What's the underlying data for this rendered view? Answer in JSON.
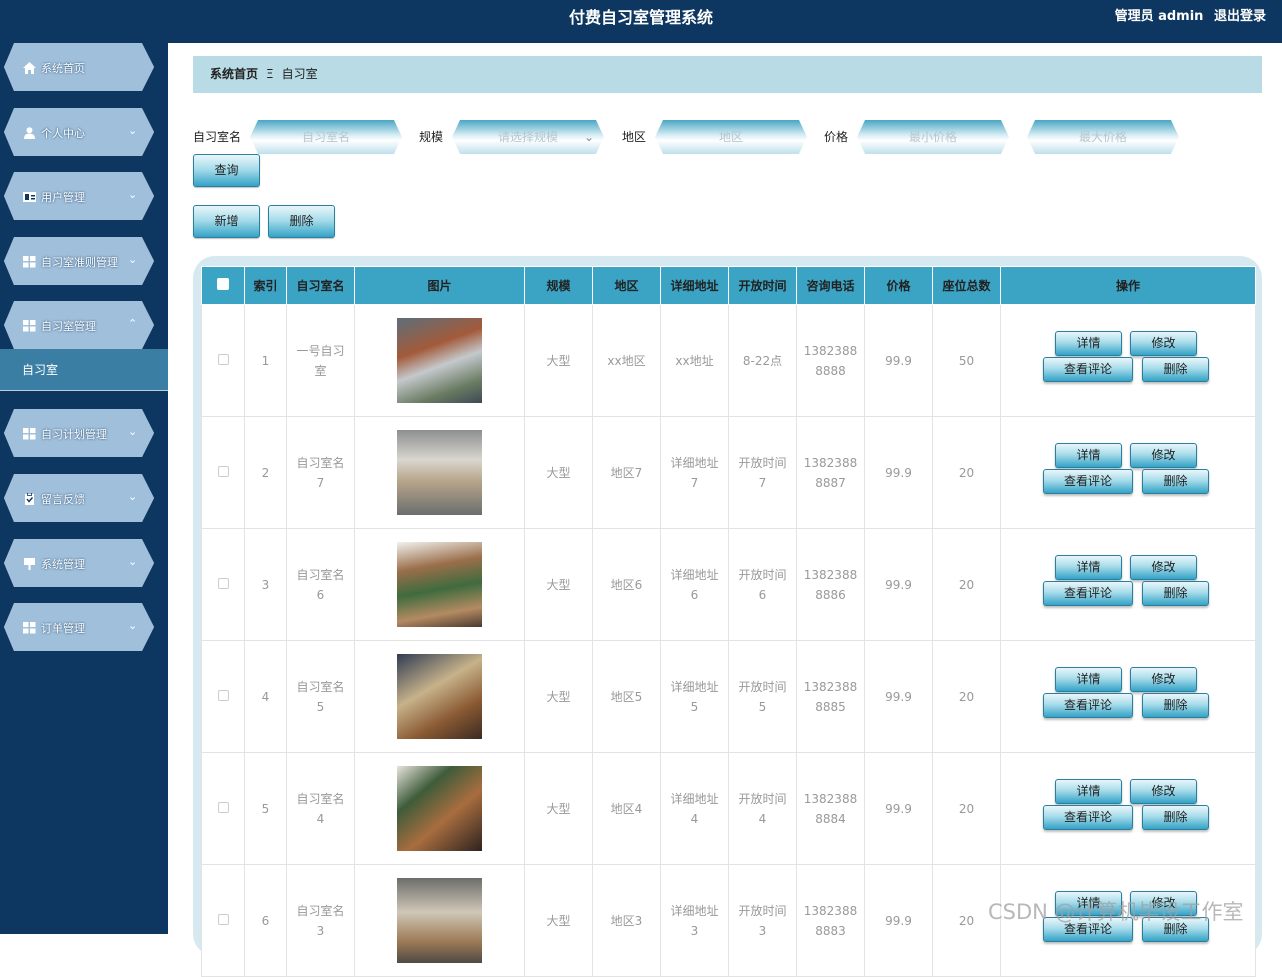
{
  "header": {
    "title": "付费自习室管理系统",
    "user_label": "管理员 admin",
    "logout_label": "退出登录"
  },
  "sidebar": {
    "items": [
      {
        "label": "系统首页",
        "icon": "home-icon",
        "chevron": ""
      },
      {
        "label": "个人中心",
        "icon": "user-icon",
        "chevron": "⌄"
      },
      {
        "label": "用户管理",
        "icon": "id-card-icon",
        "chevron": "⌄"
      },
      {
        "label": "自习室准则管理",
        "icon": "grid-icon",
        "chevron": "⌄"
      },
      {
        "label": "自习室管理",
        "icon": "grid-icon",
        "chevron": "⌃"
      },
      {
        "label": "自习计划管理",
        "icon": "grid-icon",
        "chevron": "⌄"
      },
      {
        "label": "留言反馈",
        "icon": "clipboard-icon",
        "chevron": "⌄"
      },
      {
        "label": "系统管理",
        "icon": "sign-icon",
        "chevron": "⌄"
      },
      {
        "label": "订单管理",
        "icon": "grid-icon",
        "chevron": "⌄"
      }
    ],
    "active_sub": "自习室"
  },
  "breadcrumb": {
    "home": "系统首页",
    "sep": "Ξ",
    "current": "自习室"
  },
  "filters": {
    "name_label": "自习室名",
    "name_placeholder": "自习室名",
    "scale_label": "规模",
    "scale_placeholder": "请选择规模",
    "region_label": "地区",
    "region_placeholder": "地区",
    "price_label": "价格",
    "min_placeholder": "最小价格",
    "max_placeholder": "最大价格",
    "query_label": "查询"
  },
  "actions": {
    "add_label": "新增",
    "delete_label": "删除"
  },
  "table": {
    "headers": [
      "索引",
      "自习室名",
      "图片",
      "规模",
      "地区",
      "详细地址",
      "开放时间",
      "咨询电话",
      "价格",
      "座位总数",
      "操作"
    ],
    "op_labels": {
      "detail": "详情",
      "edit": "修改",
      "reviews": "查看评论",
      "delete": "删除"
    },
    "rows": [
      {
        "index": "1",
        "name": "一号自习室",
        "scale": "大型",
        "region": "xx地区",
        "address": "xx地址",
        "hours": "8-22点",
        "phone": "13823888888",
        "price": "99.9",
        "seats": "50"
      },
      {
        "index": "2",
        "name": "自习室名7",
        "scale": "大型",
        "region": "地区7",
        "address": "详细地址7",
        "hours": "开放时间7",
        "phone": "13823888887",
        "price": "99.9",
        "seats": "20"
      },
      {
        "index": "3",
        "name": "自习室名6",
        "scale": "大型",
        "region": "地区6",
        "address": "详细地址6",
        "hours": "开放时间6",
        "phone": "13823888886",
        "price": "99.9",
        "seats": "20"
      },
      {
        "index": "4",
        "name": "自习室名5",
        "scale": "大型",
        "region": "地区5",
        "address": "详细地址5",
        "hours": "开放时间5",
        "phone": "13823888885",
        "price": "99.9",
        "seats": "20"
      },
      {
        "index": "5",
        "name": "自习室名4",
        "scale": "大型",
        "region": "地区4",
        "address": "详细地址4",
        "hours": "开放时间4",
        "phone": "13823888884",
        "price": "99.9",
        "seats": "20"
      },
      {
        "index": "6",
        "name": "自习室名3",
        "scale": "大型",
        "region": "地区3",
        "address": "详细地址3",
        "hours": "开放时间3",
        "phone": "13823888883",
        "price": "99.9",
        "seats": "20"
      }
    ]
  },
  "watermark": "CSDN @计算机毕设工作室",
  "colors": {
    "nav_bg": "#0d3660",
    "accent": "#3ba3c4",
    "breadcrumb_bg": "#b8dbe5"
  }
}
